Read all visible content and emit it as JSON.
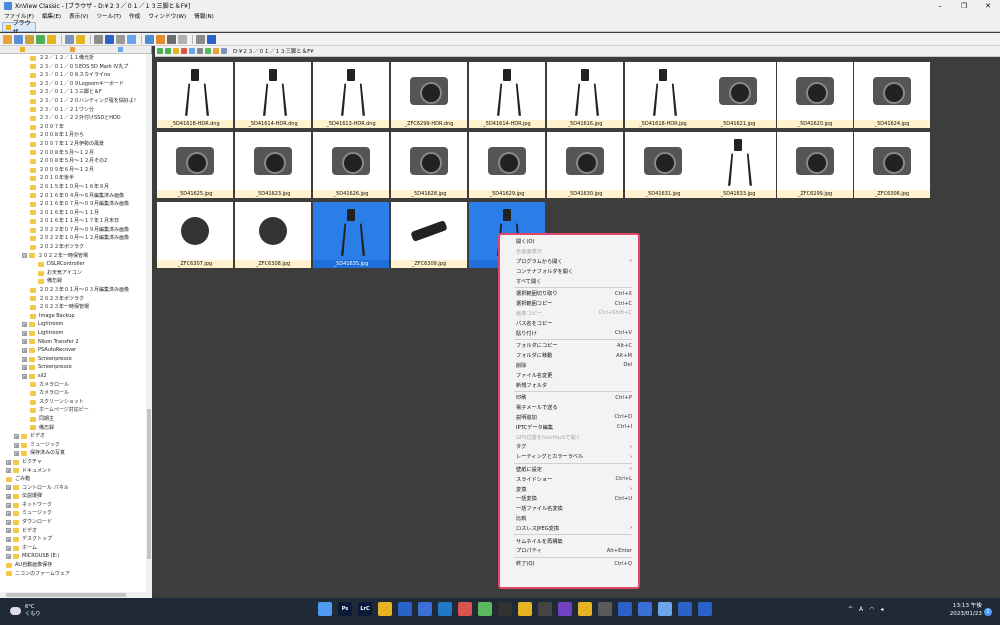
{
  "window": {
    "title": "XnView Classic - [ブラウザ - D:¥２３／０１／１３三脚と＆F¥]",
    "min": "–",
    "max": "❐",
    "close": "✕"
  },
  "menu": [
    "ファイル(F)",
    "編集(E)",
    "表示(V)",
    "ツール(T)",
    "作成",
    "ウィンドウ(W)",
    "情報(N)"
  ],
  "tab_label": "ブラウザ",
  "address": "D:¥２３／０１／１３三脚と＆F¥",
  "tree": [
    {
      "label": "２２／１２／１１備光折",
      "indent": 30
    },
    {
      "label": "２３／０１／０５EOS 5D Mark IV丸プ",
      "indent": 30
    },
    {
      "label": "２３／０１／０８スカイライno",
      "indent": 30
    },
    {
      "label": "２３／０１／０９Logoomキーボード",
      "indent": 30
    },
    {
      "label": "２３／０１／１３三脚と＆F",
      "indent": 30
    },
    {
      "label": "２３／０１／２０ハンティング罹を悩好よ！",
      "indent": 30
    },
    {
      "label": "２３／０１／２１ワシ分",
      "indent": 30
    },
    {
      "label": "２３／０１／２２外付けSSDとHDD",
      "indent": 30
    },
    {
      "label": "２００７年",
      "indent": 30
    },
    {
      "label": "２００８年１月から",
      "indent": 30
    },
    {
      "label": "２００７年１２月伊勢の風景",
      "indent": 30
    },
    {
      "label": "２００８年５月～１２月",
      "indent": 30
    },
    {
      "label": "２００８年５月～１２月その2",
      "indent": 30
    },
    {
      "label": "２００９年６月～１２月",
      "indent": 30
    },
    {
      "label": "２０１０年後半",
      "indent": 30
    },
    {
      "label": "２０１５年１０月～１６年９月",
      "indent": 30
    },
    {
      "label": "２０１６年０４月～６月編集済み画像",
      "indent": 30
    },
    {
      "label": "２０１６年０７月～０９月編集済み画像",
      "indent": 30
    },
    {
      "label": "２０１６年１０月～１１月",
      "indent": 30
    },
    {
      "label": "２０１６年１１月～１７年１月末日",
      "indent": 30
    },
    {
      "label": "２０２２年０７月～０９月編集済み画像",
      "indent": 30
    },
    {
      "label": "２０２２年１０月～１２月編集済み画像",
      "indent": 30
    },
    {
      "label": "２０２２年ボツラク",
      "indent": 30
    },
    {
      "label": "２０２２年一時保管場",
      "indent": 22,
      "expand": "⊟"
    },
    {
      "label": "DSLRController",
      "indent": 38
    },
    {
      "label": "お天気アイコン",
      "indent": 38
    },
    {
      "label": "備忘録",
      "indent": 38
    },
    {
      "label": "２０２３年０１月～０３月編集済み画像",
      "indent": 30
    },
    {
      "label": "２０２３年ボツラク",
      "indent": 30
    },
    {
      "label": "２０２３年一時保管場",
      "indent": 30
    },
    {
      "label": "Image Backup",
      "indent": 30
    },
    {
      "label": "Lightroom",
      "indent": 22,
      "expand": "⊞"
    },
    {
      "label": "Lightroom",
      "indent": 22,
      "expand": "⊞"
    },
    {
      "label": "Nikon Transfer 2",
      "indent": 22,
      "expand": "⊞"
    },
    {
      "label": "PSAutoRecover",
      "indent": 22,
      "expand": "⊞"
    },
    {
      "label": "Screenpresso",
      "indent": 22,
      "expand": "⊞"
    },
    {
      "label": "Screenpresso",
      "indent": 22,
      "expand": "⊞"
    },
    {
      "label": "sil2",
      "indent": 22,
      "expand": "⊞"
    },
    {
      "label": "カメラロール",
      "indent": 30
    },
    {
      "label": "カメラロール",
      "indent": 30
    },
    {
      "label": "スクリーンショット",
      "indent": 30
    },
    {
      "label": "ホームページ対応ビー",
      "indent": 30
    },
    {
      "label": "同期主",
      "indent": 30
    },
    {
      "label": "備忘録",
      "indent": 30
    },
    {
      "label": "ビデオ",
      "indent": 14,
      "expand": "⊞"
    },
    {
      "label": "ミュージック",
      "indent": 14,
      "expand": "⊞"
    },
    {
      "label": "保存済みの写真",
      "indent": 14,
      "expand": "⊞"
    },
    {
      "label": "ピクチャ",
      "indent": 6,
      "expand": "⊞"
    },
    {
      "label": "ドキュメント",
      "indent": 6,
      "expand": "⊞"
    },
    {
      "label": "ごみ箱",
      "indent": 6
    },
    {
      "label": "コントロール パネル",
      "indent": 6,
      "expand": "⊞"
    },
    {
      "label": "伝説爆弾",
      "indent": 6,
      "expand": "⊞"
    },
    {
      "label": "ネットワーク",
      "indent": 6,
      "expand": "⊞"
    },
    {
      "label": "ミュージック",
      "indent": 6,
      "expand": "⊞"
    },
    {
      "label": "ダウンロード",
      "indent": 6,
      "expand": "⊞"
    },
    {
      "label": "ビデオ",
      "indent": 6,
      "expand": "⊞"
    },
    {
      "label": "デスクトップ",
      "indent": 6,
      "expand": "⊞"
    },
    {
      "label": "ホーム",
      "indent": 6,
      "expand": "⊞"
    },
    {
      "label": "MICROUSB (E:)",
      "indent": 6,
      "expand": "⊞"
    },
    {
      "label": "AU自動画像保存",
      "indent": 6
    },
    {
      "label": "ニコンのファームウェア",
      "indent": 6
    }
  ],
  "thumbnails": [
    {
      "name": "_5D41618-HDR.dng",
      "kind": "tripod",
      "selected": false
    },
    {
      "name": "_5D41614-HDR.dng",
      "kind": "tripod",
      "selected": false
    },
    {
      "name": "_5D41613-HDR.dng",
      "kind": "tripod",
      "selected": false
    },
    {
      "name": "_ZFC6299-HDR.dng",
      "kind": "cam",
      "selected": false
    },
    {
      "name": "_5D41614-HDR.jpg",
      "kind": "tripod",
      "selected": false
    },
    {
      "name": "_5D41616.jpg",
      "kind": "tripod",
      "selected": false
    },
    {
      "name": "_5D41618-HDR.jpg",
      "kind": "tripod",
      "selected": false
    },
    {
      "name": "_5D41621.jpg",
      "kind": "cam",
      "selected": false
    },
    {
      "name": "_5D41620.jpg",
      "kind": "cam",
      "selected": false
    },
    {
      "name": "_5D41624.jpg",
      "kind": "cam",
      "selected": false
    },
    {
      "name": "_5D41625.jpg",
      "kind": "cam",
      "selected": false
    },
    {
      "name": "_5D41623.jpg",
      "kind": "cam",
      "selected": false
    },
    {
      "name": "_5D41626.jpg",
      "kind": "cam",
      "selected": false
    },
    {
      "name": "_5D41628.jpg",
      "kind": "cam",
      "selected": false
    },
    {
      "name": "_5D41629.jpg",
      "kind": "cam",
      "selected": false
    },
    {
      "name": "_5D41630.jpg",
      "kind": "cam",
      "selected": false
    },
    {
      "name": "_5D41631.jpg",
      "kind": "cam",
      "selected": false
    },
    {
      "name": "_5D41633.jpg",
      "kind": "tripod",
      "selected": false
    },
    {
      "name": "_ZFC6299.jpg",
      "kind": "cam",
      "selected": false
    },
    {
      "name": "_ZFC6306.jpg",
      "kind": "cam",
      "selected": false
    },
    {
      "name": "_ZFC6307.jpg",
      "kind": "part",
      "selected": false
    },
    {
      "name": "_ZFC6308.jpg",
      "kind": "part",
      "selected": false
    },
    {
      "name": "_5D41635.jpg",
      "kind": "tripod",
      "selected": true
    },
    {
      "name": "_ZFC6309.jpg",
      "kind": "arm",
      "selected": false
    },
    {
      "name": "_5D",
      "kind": "tripod",
      "selected": true
    }
  ],
  "context_menu": [
    {
      "label": "開く(O)"
    },
    {
      "label": "全画面表示",
      "disabled": true
    },
    {
      "label": "プログラムから開く",
      "sub": true
    },
    {
      "label": "コンテナフォルダを開く"
    },
    {
      "label": "すべて開く"
    },
    {
      "sep": true
    },
    {
      "label": "選択範囲切り取り",
      "shortcut": "Ctrl+X"
    },
    {
      "label": "選択範囲コピー",
      "shortcut": "Ctrl+C"
    },
    {
      "label": "画像コピー",
      "shortcut": "Ctrl+Shift+C",
      "disabled": true
    },
    {
      "label": "パス名をコピー"
    },
    {
      "label": "貼り付け",
      "shortcut": "Ctrl+V"
    },
    {
      "sep": true
    },
    {
      "label": "フォルダにコピー",
      "shortcut": "Alt+C"
    },
    {
      "label": "フォルダに移動",
      "shortcut": "Alt+M"
    },
    {
      "label": "削除",
      "shortcut": "Del"
    },
    {
      "label": "ファイル名変更"
    },
    {
      "label": "新規フォルダ"
    },
    {
      "sep": true
    },
    {
      "label": "印刷",
      "shortcut": "Ctrl+P"
    },
    {
      "label": "電子メールで送る"
    },
    {
      "label": "説明追加",
      "shortcut": "Ctrl+D"
    },
    {
      "label": "IPTCデータ編集",
      "shortcut": "Ctrl+I"
    },
    {
      "label": "GPS位置をGeoHackで開く",
      "disabled": true
    },
    {
      "label": "タグ",
      "sub": true
    },
    {
      "label": "レーティングとカラーラベル",
      "sub": true
    },
    {
      "sep": true
    },
    {
      "label": "壁紙に設定",
      "sub": true
    },
    {
      "label": "スライドショー",
      "shortcut": "Ctrl+L"
    },
    {
      "label": "変換",
      "sub": true
    },
    {
      "label": "一括変換",
      "shortcut": "Ctrl+U"
    },
    {
      "label": "一括ファイル名変換"
    },
    {
      "label": "比較"
    },
    {
      "label": "ロスレスJPEG変換",
      "sub": true
    },
    {
      "sep": true
    },
    {
      "label": "サムネイルを再構築"
    },
    {
      "label": "プロパティ",
      "shortcut": "Alt+Enter"
    },
    {
      "sep": true
    },
    {
      "label": "終了(Q)",
      "shortcut": "Ctrl+Q"
    }
  ],
  "taskbar": {
    "temp": "6°C",
    "weather": "くもり",
    "apps": [
      "",
      "Ps",
      "LrC",
      "",
      "",
      "",
      "",
      "",
      "",
      "",
      "",
      "",
      "",
      "",
      "",
      "",
      "",
      "",
      "",
      "",
      ""
    ],
    "app_colors": [
      "#4f9cf2",
      "#0a1a3a",
      "#0a1a3a",
      "#e6b422",
      "#2a62c9",
      "#3a6fd8",
      "#2178c9",
      "#d9534f",
      "#5cb85c",
      "#333",
      "#e6b422",
      "#444",
      "#6f42c1",
      "#e6b422",
      "#5a5a5a",
      "#2a62c9",
      "#3a6fd8",
      "#6aa4ea",
      "#2a62c9",
      "#2a62c9"
    ],
    "time": "13:13 午後",
    "date": "2023/01/23",
    "ime": "A",
    "notif_count": "2"
  }
}
